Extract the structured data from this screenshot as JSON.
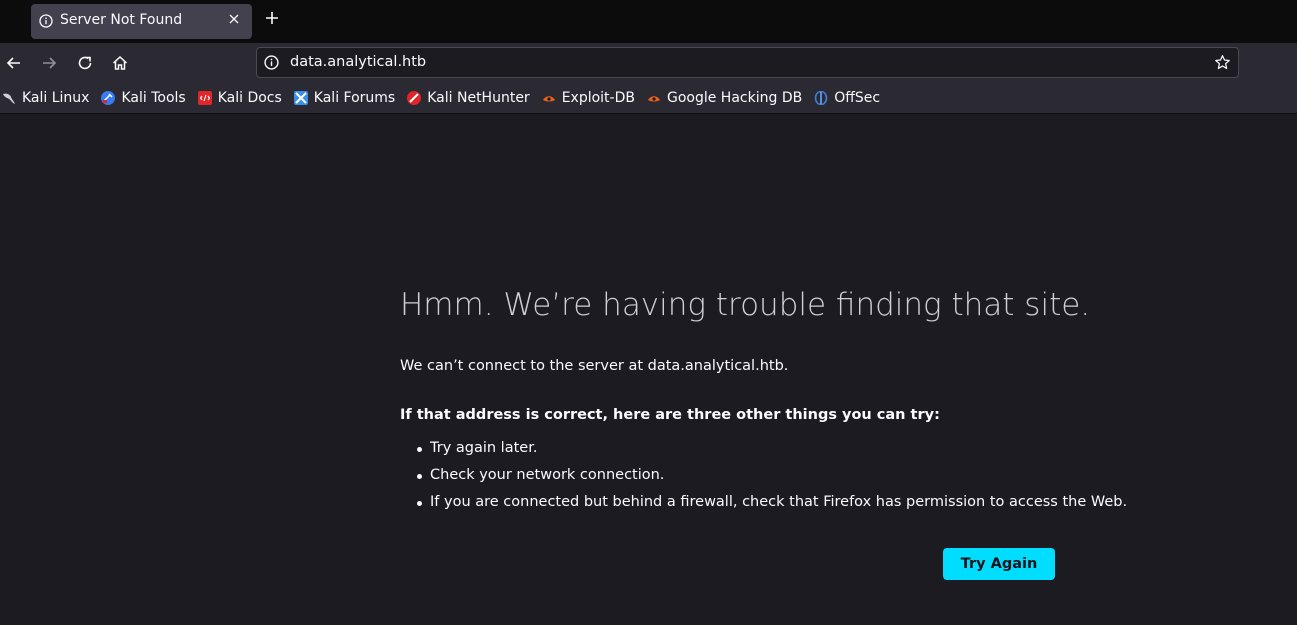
{
  "tab": {
    "title": "Server Not Found",
    "icon": "info-icon",
    "close_icon": "close-icon"
  },
  "new_tab_icon": "plus-icon",
  "nav": {
    "back_icon": "back-arrow-icon",
    "forward_icon": "forward-arrow-icon",
    "reload_icon": "reload-icon",
    "home_icon": "home-icon",
    "url": "data.analytical.htb",
    "bookmark_star_icon": "star-icon"
  },
  "bookmarks": [
    {
      "label": "Kali Linux",
      "icon": "kali-dragon-icon",
      "color": "#3d6fb5"
    },
    {
      "label": "Kali Tools",
      "icon": "kali-tools-icon",
      "color": "#367bf0"
    },
    {
      "label": "Kali Docs",
      "icon": "kali-docs-icon",
      "color": "#e0252b"
    },
    {
      "label": "Kali Forums",
      "icon": "kali-forums-icon",
      "color": "#3b8ee8"
    },
    {
      "label": "Kali NetHunter",
      "icon": "kali-nethunter-icon",
      "color": "#e0252b"
    },
    {
      "label": "Exploit-DB",
      "icon": "exploit-db-icon",
      "color": "#e8621c"
    },
    {
      "label": "Google Hacking DB",
      "icon": "ghdb-icon",
      "color": "#e8621c"
    },
    {
      "label": "OffSec",
      "icon": "offsec-icon",
      "color": "#3f7dd8"
    }
  ],
  "error": {
    "title": "Hmm. We’re having trouble finding that site.",
    "description": "We can’t connect to the server at data.analytical.htb.",
    "suggestions_heading": "If that address is correct, here are three other things you can try:",
    "suggestions": [
      "Try again later.",
      "Check your network connection.",
      "If you are connected but behind a firewall, check that Firefox has permission to access the Web."
    ],
    "button_label": "Try Again"
  },
  "colors": {
    "accent": "#00ddff",
    "page_bg": "#1c1b22",
    "toolbar_bg": "#2b2a33"
  }
}
